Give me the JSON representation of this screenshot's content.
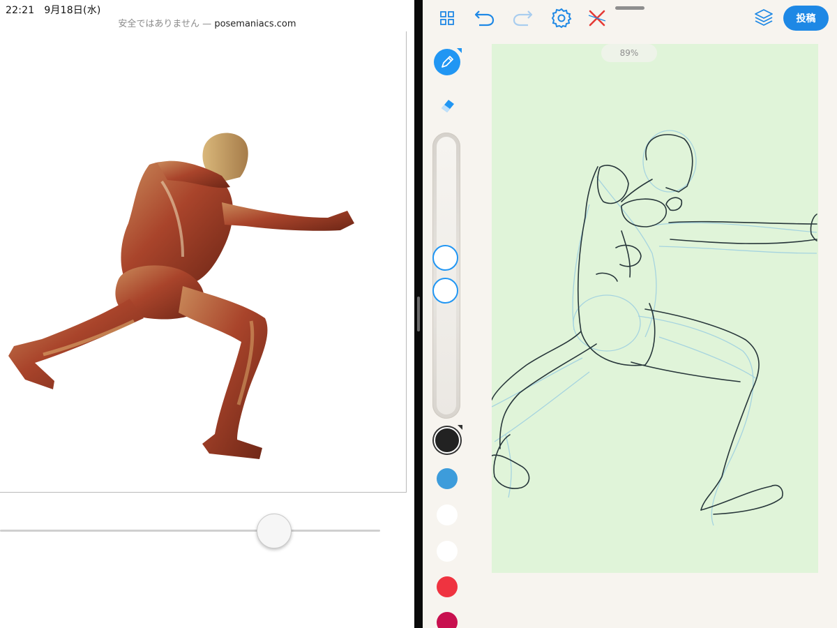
{
  "status_bar": {
    "time": "22:21",
    "date": "9月18日(水)"
  },
  "browser": {
    "security_label": "安全ではありません",
    "separator": " — ",
    "host": "posemaniacs.com"
  },
  "viewer": {
    "rotation_slider_value": 0.73
  },
  "toolbar": {
    "gallery_icon": "grid-icon",
    "undo_icon": "undo-icon",
    "redo_icon": "redo-icon",
    "settings_icon": "gear-icon",
    "close_icon": "close-icon",
    "layers_icon": "layers-icon",
    "post_label": "投稿"
  },
  "canvas": {
    "zoom_label": "89%",
    "background_color": "#e0f4d9"
  },
  "tools": {
    "active": "pen",
    "pen_icon": "pencil-icon",
    "eraser_icon": "eraser-icon",
    "brush_size_position": 0.43,
    "brush_opacity_position": 0.56
  },
  "colors": {
    "selected": 0,
    "swatches": [
      "#222222",
      "#3d9cdb",
      "#ffffff",
      "#ffffff",
      "#ef3340",
      "#c8104f"
    ],
    "accent": "#2196f3"
  }
}
